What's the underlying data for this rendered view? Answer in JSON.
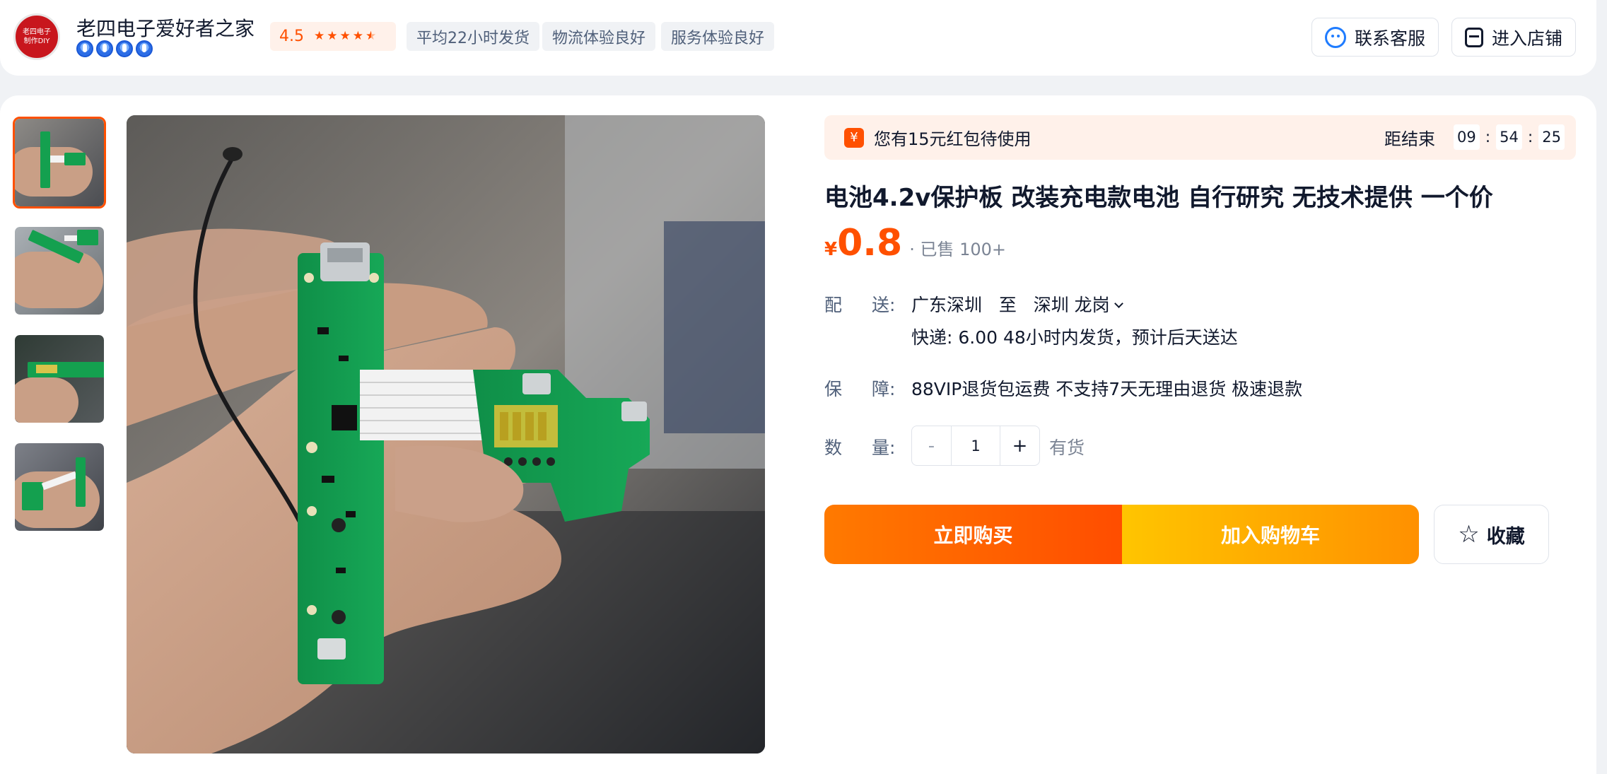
{
  "shop": {
    "logo_text_line1": "老四电子",
    "logo_text_line2": "制作DIY",
    "name": "老四电子爱好者之家",
    "level_icons": [
      "diamond-level-icon",
      "diamond-level-icon",
      "diamond-level-icon",
      "diamond-level-icon"
    ],
    "rating": "4.5",
    "stars": 4.5,
    "tags": [
      "平均22小时发货",
      "物流体验良好",
      "服务体验良好"
    ],
    "contact_label": "联系客服",
    "store_label": "进入店铺"
  },
  "gallery": {
    "thumbnail_count": 4,
    "selected_index": 0
  },
  "coupon": {
    "icon": "¥",
    "text": "您有15元红包待使用",
    "countdown_label": "距结束",
    "hours": "09",
    "minutes": "54",
    "seconds": "25",
    "separator": ":"
  },
  "product": {
    "title": "电池4.2v保护板 改装充电款电池 自行研究 无技术提供 一个价",
    "price_symbol": "¥",
    "price": "0.8",
    "sold": "· 已售 100+"
  },
  "shipping": {
    "label_a": "配",
    "label_b": "送:",
    "from": "广东深圳",
    "to_word": "至",
    "destination": "深圳 龙岗",
    "detail": "快递: 6.00  48小时内发货，预计后天送达"
  },
  "guarantee": {
    "label_a": "保",
    "label_b": "障:",
    "text": "88VIP退货包运费 不支持7天无理由退货 极速退款"
  },
  "quantity": {
    "label_a": "数",
    "label_b": "量:",
    "minus": "-",
    "value": "1",
    "plus": "+",
    "stock": "有货"
  },
  "actions": {
    "buy_now": "立即购买",
    "add_to_cart": "加入购物车",
    "favorite": "收藏"
  },
  "colors": {
    "accent": "#ff5000",
    "cart_gradient_start": "#ffc500",
    "buy_gradient_start": "#ff7a00"
  }
}
